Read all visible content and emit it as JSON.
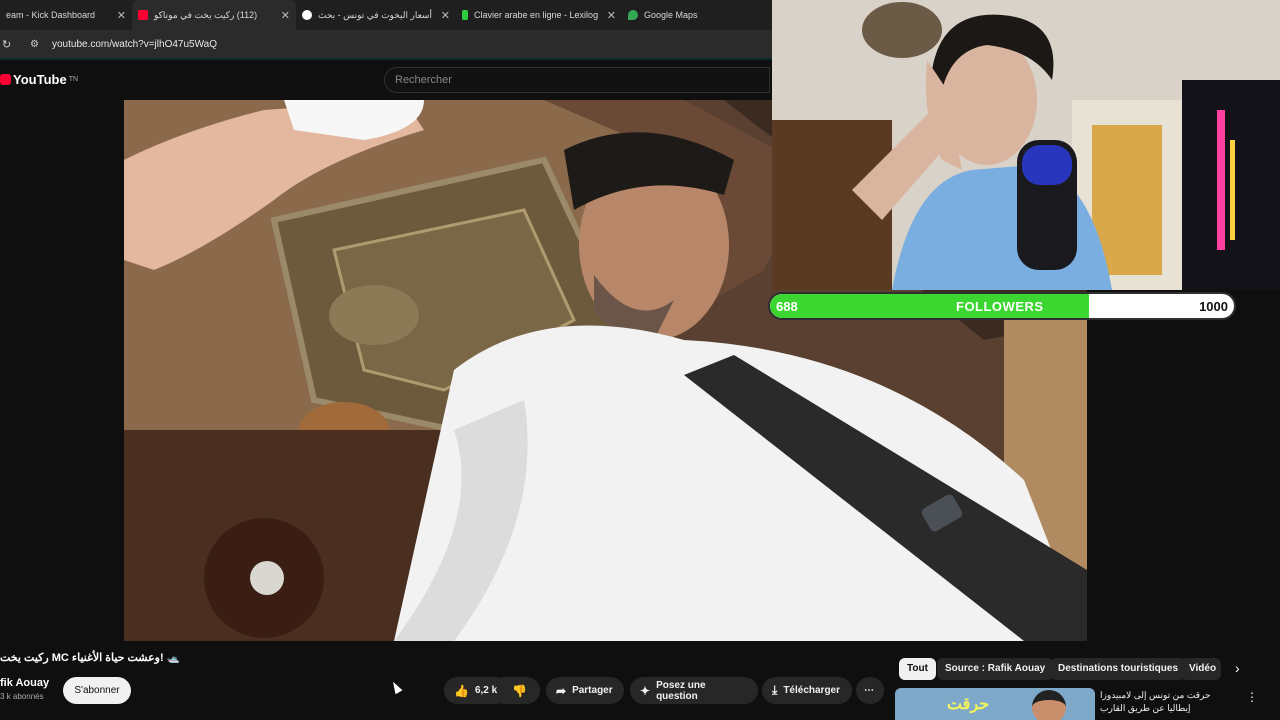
{
  "browser": {
    "tabs": [
      {
        "title": "eam - Kick Dashboard",
        "favicon_color": "#53fc18",
        "active": false
      },
      {
        "title": "(112) ركيت يخت في موناكو",
        "favicon_color": "#ff0033",
        "active": true
      },
      {
        "title": "أسعار اليخوت في تونس - بحث",
        "favicon_color": "#ffffff",
        "active": false
      },
      {
        "title": "Clavier arabe en ligne - Lexilog",
        "favicon_color": "#2ecc40",
        "active": false
      },
      {
        "title": "Google Maps",
        "favicon_color": "#34a853",
        "active": false
      }
    ],
    "url": "youtube.com/watch?v=jlhO47u5WaQ"
  },
  "youtube": {
    "logo_text": "YouTube",
    "region": "TN",
    "search_placeholder": "Rechercher",
    "video_title": "🛥️ !وعشت حياة الأغنياء MC ركيت يخت",
    "channel_name": "fik Aouay",
    "subscribers": "3 k abonnés",
    "subscribe_label": "S'abonner",
    "likes": "6,2 k",
    "share_label": "Partager",
    "ask_label": "Posez une question",
    "download_label": "Télécharger",
    "more_label": "⋯",
    "chips": [
      "Tout",
      "Source : Rafik Aouay",
      "Destinations touristiques",
      "Vidéo"
    ],
    "recommendation": {
      "thumb_text": "حرقت",
      "title": "حرقت من تونس إلى لامبيدوزا إيطاليا عن طريق القارب"
    }
  },
  "stream_overlay": {
    "followers_current": 688,
    "followers_goal": 1000,
    "followers_label": "FOLLOWERS",
    "current_text": "688",
    "goal_text": "1000"
  },
  "colors": {
    "accent_green": "#3bd630",
    "youtube_red": "#ff0033"
  }
}
